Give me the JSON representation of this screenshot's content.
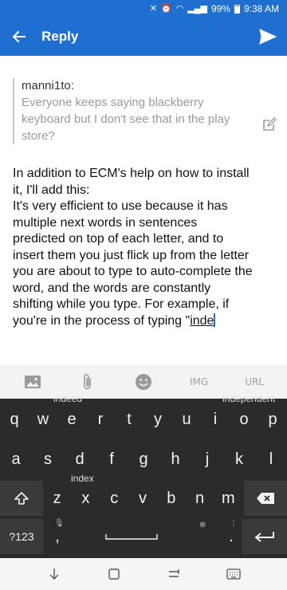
{
  "status_bar": {
    "battery": "99%",
    "time": "9:38 AM"
  },
  "app_bar": {
    "title": "Reply"
  },
  "quote": {
    "author": "manni1to:",
    "lines": [
      "Everyone keeps saying blackberry",
      "keyboard but I don't see that in the play",
      "store?"
    ]
  },
  "body": {
    "lines": [
      "In addition to ECM's help on how to install",
      "it, I'll add this:",
      "It's very efficient to use because it has",
      "multiple next words in sentences",
      "predicted on top of each letter, and to",
      "insert them you just flick up from the letter",
      "you are about to type to auto-complete the",
      "word, and the words are constantly",
      "shifting while you type. For example, if"
    ],
    "last_line_prefix": "you're in the process of typing \"",
    "typed_word": "inde"
  },
  "attachment_bar": {
    "img_label": "IMG",
    "url_label": "URL"
  },
  "keyboard": {
    "suggestions": {
      "e": "indeed",
      "p": "independent",
      "x": "index"
    },
    "row1": [
      "q",
      "w",
      "e",
      "r",
      "t",
      "y",
      "u",
      "i",
      "o",
      "p"
    ],
    "row2": [
      "a",
      "s",
      "d",
      "f",
      "g",
      "h",
      "j",
      "k",
      "l"
    ],
    "row3": [
      "z",
      "x",
      "c",
      "v",
      "b",
      "n",
      "m"
    ],
    "symbols_label": "?123",
    "comma_label": ",",
    "period_label": "."
  }
}
